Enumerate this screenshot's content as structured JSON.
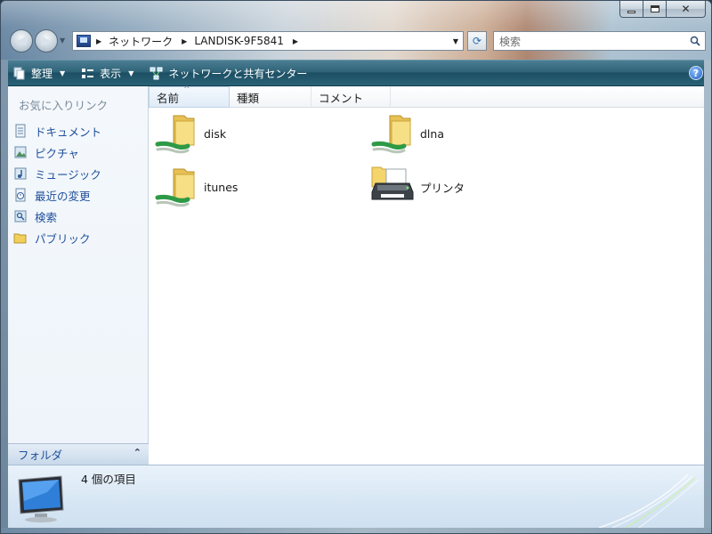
{
  "window": {
    "minimize_label": "",
    "maximize_label": "",
    "close_label": "✕"
  },
  "address": {
    "crumbs": [
      "ネットワーク",
      "LANDISK-9F5841"
    ]
  },
  "search": {
    "placeholder": "検索"
  },
  "toolbar": {
    "organize_label": "整理",
    "views_label": "表示",
    "network_center_label": "ネットワークと共有センター",
    "help_label": "?"
  },
  "sidebar": {
    "favorites_header": "お気に入りリンク",
    "items": [
      {
        "label": "ドキュメント",
        "icon": "documents-icon"
      },
      {
        "label": "ピクチャ",
        "icon": "pictures-icon"
      },
      {
        "label": "ミュージック",
        "icon": "music-icon"
      },
      {
        "label": "最近の変更",
        "icon": "recent-changes-icon"
      },
      {
        "label": "検索",
        "icon": "searches-icon"
      },
      {
        "label": "パブリック",
        "icon": "public-folder-icon"
      }
    ],
    "folders_label": "フォルダ"
  },
  "columns": {
    "name": "名前",
    "type": "種類",
    "comment": "コメント"
  },
  "files": [
    {
      "label": "disk",
      "icon": "shared-folder-icon"
    },
    {
      "label": "dlna",
      "icon": "shared-folder-icon"
    },
    {
      "label": "itunes",
      "icon": "shared-folder-icon"
    },
    {
      "label": "プリンタ",
      "icon": "printer-icon"
    }
  ],
  "details": {
    "item_count_text": "4 個の項目"
  },
  "colors": {
    "command_bar": "#2f6378",
    "link_blue": "#1f4f9a",
    "folder_yellow": "#f3d56b",
    "share_green": "#3aa84a"
  }
}
